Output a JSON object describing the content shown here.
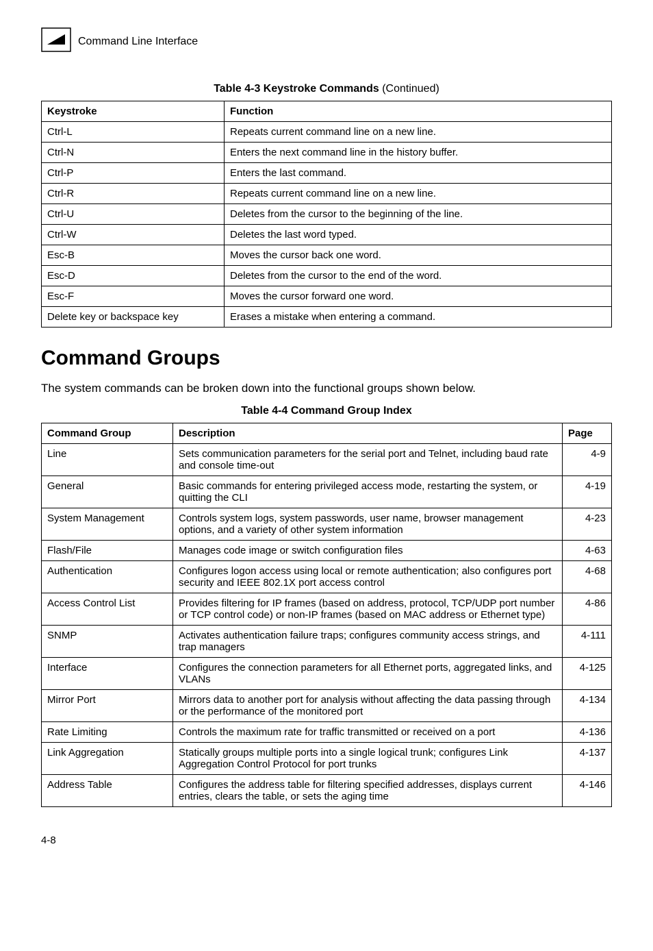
{
  "header": {
    "label": "Command Line Interface"
  },
  "table1": {
    "caption_prefix": "Table 4-3  Keystroke Commands",
    "caption_suffix": " (Continued)",
    "headers": [
      "Keystroke",
      "Function"
    ],
    "rows": [
      {
        "k": "Ctrl-L",
        "f": "Repeats current command line on a new line."
      },
      {
        "k": "Ctrl-N",
        "f": "Enters the next command line in the history buffer."
      },
      {
        "k": "Ctrl-P",
        "f": "Enters the last command."
      },
      {
        "k": "Ctrl-R",
        "f": "Repeats current command line on a new line."
      },
      {
        "k": "Ctrl-U",
        "f": "Deletes from the cursor to the beginning of the line."
      },
      {
        "k": "Ctrl-W",
        "f": "Deletes the last word typed."
      },
      {
        "k": "Esc-B",
        "f": "Moves the cursor back one word."
      },
      {
        "k": "Esc-D",
        "f": "Deletes from the cursor to the end of the word."
      },
      {
        "k": "Esc-F",
        "f": "Moves the cursor forward one word."
      },
      {
        "k": "Delete key or backspace key",
        "f": "Erases a mistake when entering a command."
      }
    ]
  },
  "section": {
    "title": "Command Groups",
    "intro": "The system commands can be broken down into the functional groups shown below."
  },
  "table2": {
    "caption": "Table 4-4   Command Group Index",
    "headers": [
      "Command Group",
      "Description",
      "Page"
    ],
    "rows": [
      {
        "g": "Line",
        "d": "Sets communication parameters for the serial port and Telnet, including baud rate and console time-out",
        "p": "4-9"
      },
      {
        "g": "General",
        "d": "Basic commands for entering privileged access mode, restarting the system, or quitting the CLI",
        "p": "4-19"
      },
      {
        "g": "System Management",
        "d": "Controls system logs, system passwords, user name, browser management options, and a variety of other system information",
        "p": "4-23"
      },
      {
        "g": "Flash/File",
        "d": "Manages code image or switch configuration files",
        "p": "4-63"
      },
      {
        "g": "Authentication",
        "d": "Configures logon access using local or remote authentication; also configures port security and IEEE 802.1X port access control",
        "p": "4-68"
      },
      {
        "g": "Access Control List",
        "d": "Provides filtering for IP frames (based on address, protocol, TCP/UDP port number or TCP control code) or non-IP frames (based on MAC address or Ethernet type)",
        "p": "4-86"
      },
      {
        "g": "SNMP",
        "d": "Activates authentication failure traps; configures community access strings, and trap managers",
        "p": "4-111"
      },
      {
        "g": "Interface",
        "d": "Configures the connection parameters for all Ethernet ports, aggregated links, and VLANs",
        "p": "4-125"
      },
      {
        "g": "Mirror Port",
        "d": "Mirrors data to another port for analysis without affecting the data passing through or the performance of the monitored port",
        "p": "4-134"
      },
      {
        "g": "Rate Limiting",
        "d": "Controls the maximum rate for traffic transmitted or received on a port",
        "p": "4-136"
      },
      {
        "g": "Link Aggregation",
        "d": "Statically groups multiple ports into a single logical trunk; configures Link Aggregation Control Protocol for port trunks",
        "p": "4-137"
      },
      {
        "g": "Address Table",
        "d": "Configures the address table for filtering specified addresses, displays current entries, clears the table, or sets the aging time",
        "p": "4-146"
      }
    ]
  },
  "footer": {
    "page_number": "4-8"
  }
}
